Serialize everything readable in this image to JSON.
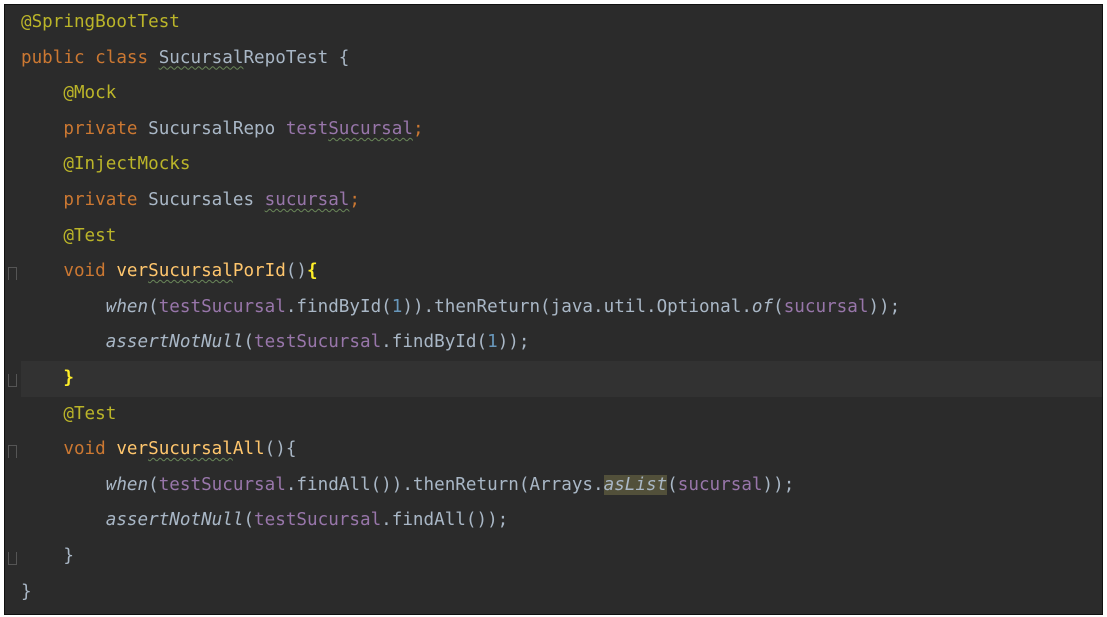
{
  "editor": {
    "lines": [
      {
        "segments": [
          {
            "t": "@SpringBootTest",
            "c": "ann"
          }
        ]
      },
      {
        "segments": [
          {
            "t": "public class ",
            "c": "kw"
          },
          {
            "t": "Sucursal",
            "c": "id typo"
          },
          {
            "t": "RepoTest {",
            "c": "id"
          }
        ]
      },
      {
        "segments": [
          {
            "t": "    "
          },
          {
            "t": "@Mock",
            "c": "ann"
          }
        ]
      },
      {
        "segments": [
          {
            "t": "    "
          },
          {
            "t": "private ",
            "c": "kw"
          },
          {
            "t": "SucursalRepo ",
            "c": "id"
          },
          {
            "t": "test",
            "c": "field"
          },
          {
            "t": "Sucursal",
            "c": "field typo"
          },
          {
            "t": ";",
            "c": "punc"
          }
        ]
      },
      {
        "segments": [
          {
            "t": "    "
          },
          {
            "t": "@InjectMocks",
            "c": "ann"
          }
        ]
      },
      {
        "segments": [
          {
            "t": "    "
          },
          {
            "t": "private ",
            "c": "kw"
          },
          {
            "t": "Sucursales ",
            "c": "id"
          },
          {
            "t": "sucursal",
            "c": "field typo"
          },
          {
            "t": ";",
            "c": "punc"
          }
        ]
      },
      {
        "segments": [
          {
            "t": "    "
          },
          {
            "t": "@Test",
            "c": "ann"
          }
        ]
      },
      {
        "segments": [
          {
            "t": "    "
          },
          {
            "t": "void ",
            "c": "kw"
          },
          {
            "t": "ver",
            "c": "fn"
          },
          {
            "t": "Sucursal",
            "c": "fn typo"
          },
          {
            "t": "PorId",
            "c": "fn"
          },
          {
            "t": "()",
            "c": "id"
          },
          {
            "t": "{",
            "c": "brace-hl"
          }
        ],
        "fold": "open"
      },
      {
        "segments": [
          {
            "t": "        "
          },
          {
            "t": "when",
            "c": "id it"
          },
          {
            "t": "(",
            "c": "id"
          },
          {
            "t": "testSucursal",
            "c": "field"
          },
          {
            "t": ".findById(",
            "c": "id"
          },
          {
            "t": "1",
            "c": "num"
          },
          {
            "t": ")).thenReturn(java.util.Optional.",
            "c": "id"
          },
          {
            "t": "of",
            "c": "id it"
          },
          {
            "t": "(",
            "c": "id"
          },
          {
            "t": "sucursal",
            "c": "field"
          },
          {
            "t": "));",
            "c": "id"
          }
        ]
      },
      {
        "segments": [
          {
            "t": "        "
          },
          {
            "t": "assertNotNull",
            "c": "id it"
          },
          {
            "t": "(",
            "c": "id"
          },
          {
            "t": "testSucursal",
            "c": "field"
          },
          {
            "t": ".findById(",
            "c": "id"
          },
          {
            "t": "1",
            "c": "num"
          },
          {
            "t": "));",
            "c": "id"
          }
        ]
      },
      {
        "segments": [
          {
            "t": "    "
          },
          {
            "t": "}",
            "c": "brace-hl"
          }
        ],
        "fold": "close",
        "current": true
      },
      {
        "segments": [
          {
            "t": "    "
          },
          {
            "t": "@Test",
            "c": "ann"
          }
        ]
      },
      {
        "segments": [
          {
            "t": "    "
          },
          {
            "t": "void ",
            "c": "kw"
          },
          {
            "t": "ver",
            "c": "fn"
          },
          {
            "t": "Sucursal",
            "c": "fn typo"
          },
          {
            "t": "All",
            "c": "fn"
          },
          {
            "t": "(){",
            "c": "id"
          }
        ],
        "fold": "open"
      },
      {
        "segments": [
          {
            "t": "        "
          },
          {
            "t": "when",
            "c": "id it"
          },
          {
            "t": "(",
            "c": "id"
          },
          {
            "t": "testSucursal",
            "c": "field"
          },
          {
            "t": ".findAll()).thenReturn(Arrays.",
            "c": "id"
          },
          {
            "t": "asList",
            "c": "id it hl-box"
          },
          {
            "t": "(",
            "c": "id"
          },
          {
            "t": "sucursal",
            "c": "field"
          },
          {
            "t": "));",
            "c": "id"
          }
        ]
      },
      {
        "segments": [
          {
            "t": "        "
          },
          {
            "t": "assertNotNull",
            "c": "id it"
          },
          {
            "t": "(",
            "c": "id"
          },
          {
            "t": "testSucursal",
            "c": "field"
          },
          {
            "t": ".findAll());",
            "c": "id"
          }
        ]
      },
      {
        "segments": [
          {
            "t": "    "
          },
          {
            "t": "}",
            "c": "id"
          }
        ],
        "fold": "close"
      },
      {
        "segments": [
          {
            "t": "}",
            "c": "id"
          }
        ]
      }
    ]
  }
}
